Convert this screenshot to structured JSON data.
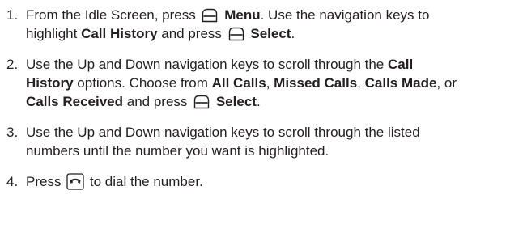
{
  "steps": [
    {
      "number": "1.",
      "lines": [
        {
          "parts": [
            {
              "t": "From the Idle Screen, press "
            },
            {
              "icon": "soft-key-icon"
            },
            {
              "t": " Menu",
              "b": true
            },
            {
              "t": ". Use the navigation keys to"
            }
          ]
        },
        {
          "parts": [
            {
              "t": "highlight "
            },
            {
              "t": "Call History",
              "b": true
            },
            {
              "t": " and press "
            },
            {
              "icon": "soft-key-icon"
            },
            {
              "t": " Select",
              "b": true
            },
            {
              "t": "."
            }
          ]
        }
      ]
    },
    {
      "number": "2.",
      "lines": [
        {
          "parts": [
            {
              "t": "Use the Up and Down navigation keys to scroll through the "
            },
            {
              "t": "Call",
              "b": true
            }
          ]
        },
        {
          "parts": [
            {
              "t": "History",
              "b": true
            },
            {
              "t": " options. Choose from "
            },
            {
              "t": "All Calls",
              "b": true
            },
            {
              "t": ", "
            },
            {
              "t": "Missed Calls",
              "b": true
            },
            {
              "t": ", "
            },
            {
              "t": "Calls Made",
              "b": true
            },
            {
              "t": ", or"
            }
          ]
        },
        {
          "parts": [
            {
              "t": "Calls Received",
              "b": true
            },
            {
              "t": " and press "
            },
            {
              "icon": "soft-key-icon"
            },
            {
              "t": " Select",
              "b": true
            },
            {
              "t": "."
            }
          ]
        }
      ]
    },
    {
      "number": "3.",
      "lines": [
        {
          "parts": [
            {
              "t": "Use the Up and Down navigation keys to scroll through the listed"
            }
          ]
        },
        {
          "parts": [
            {
              "t": "numbers until the number you want is highlighted."
            }
          ]
        }
      ]
    },
    {
      "number": "4.",
      "lines": [
        {
          "parts": [
            {
              "t": "Press "
            },
            {
              "icon": "send-key-icon"
            },
            {
              "t": " to dial the number."
            }
          ]
        }
      ]
    }
  ]
}
